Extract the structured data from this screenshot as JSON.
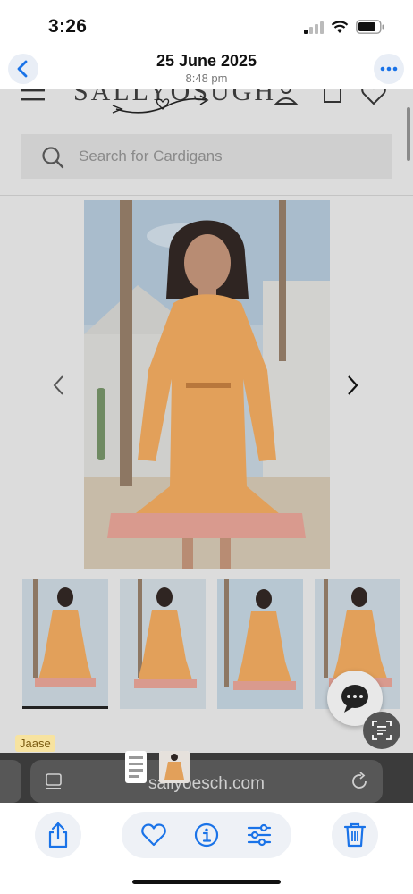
{
  "status_bar": {
    "time": "3:26"
  },
  "photos_header": {
    "date": "25 June 2025",
    "time": "8:48 pm"
  },
  "site": {
    "logo_text": "SALLYOSUGH",
    "search_placeholder": "Search for Cardigans",
    "url": "sallyoesch.com"
  },
  "tag_label": "Jaase",
  "icons": {
    "back": "chevron-left-icon",
    "more": "ellipsis-icon",
    "share": "share-icon",
    "favorite": "heart-icon",
    "info": "info-icon",
    "adjust": "sliders-icon",
    "delete": "trash-icon"
  },
  "colors": {
    "accent": "#1a73e8",
    "dress": "#e8a45a",
    "overlay": "#dcdcdc"
  }
}
